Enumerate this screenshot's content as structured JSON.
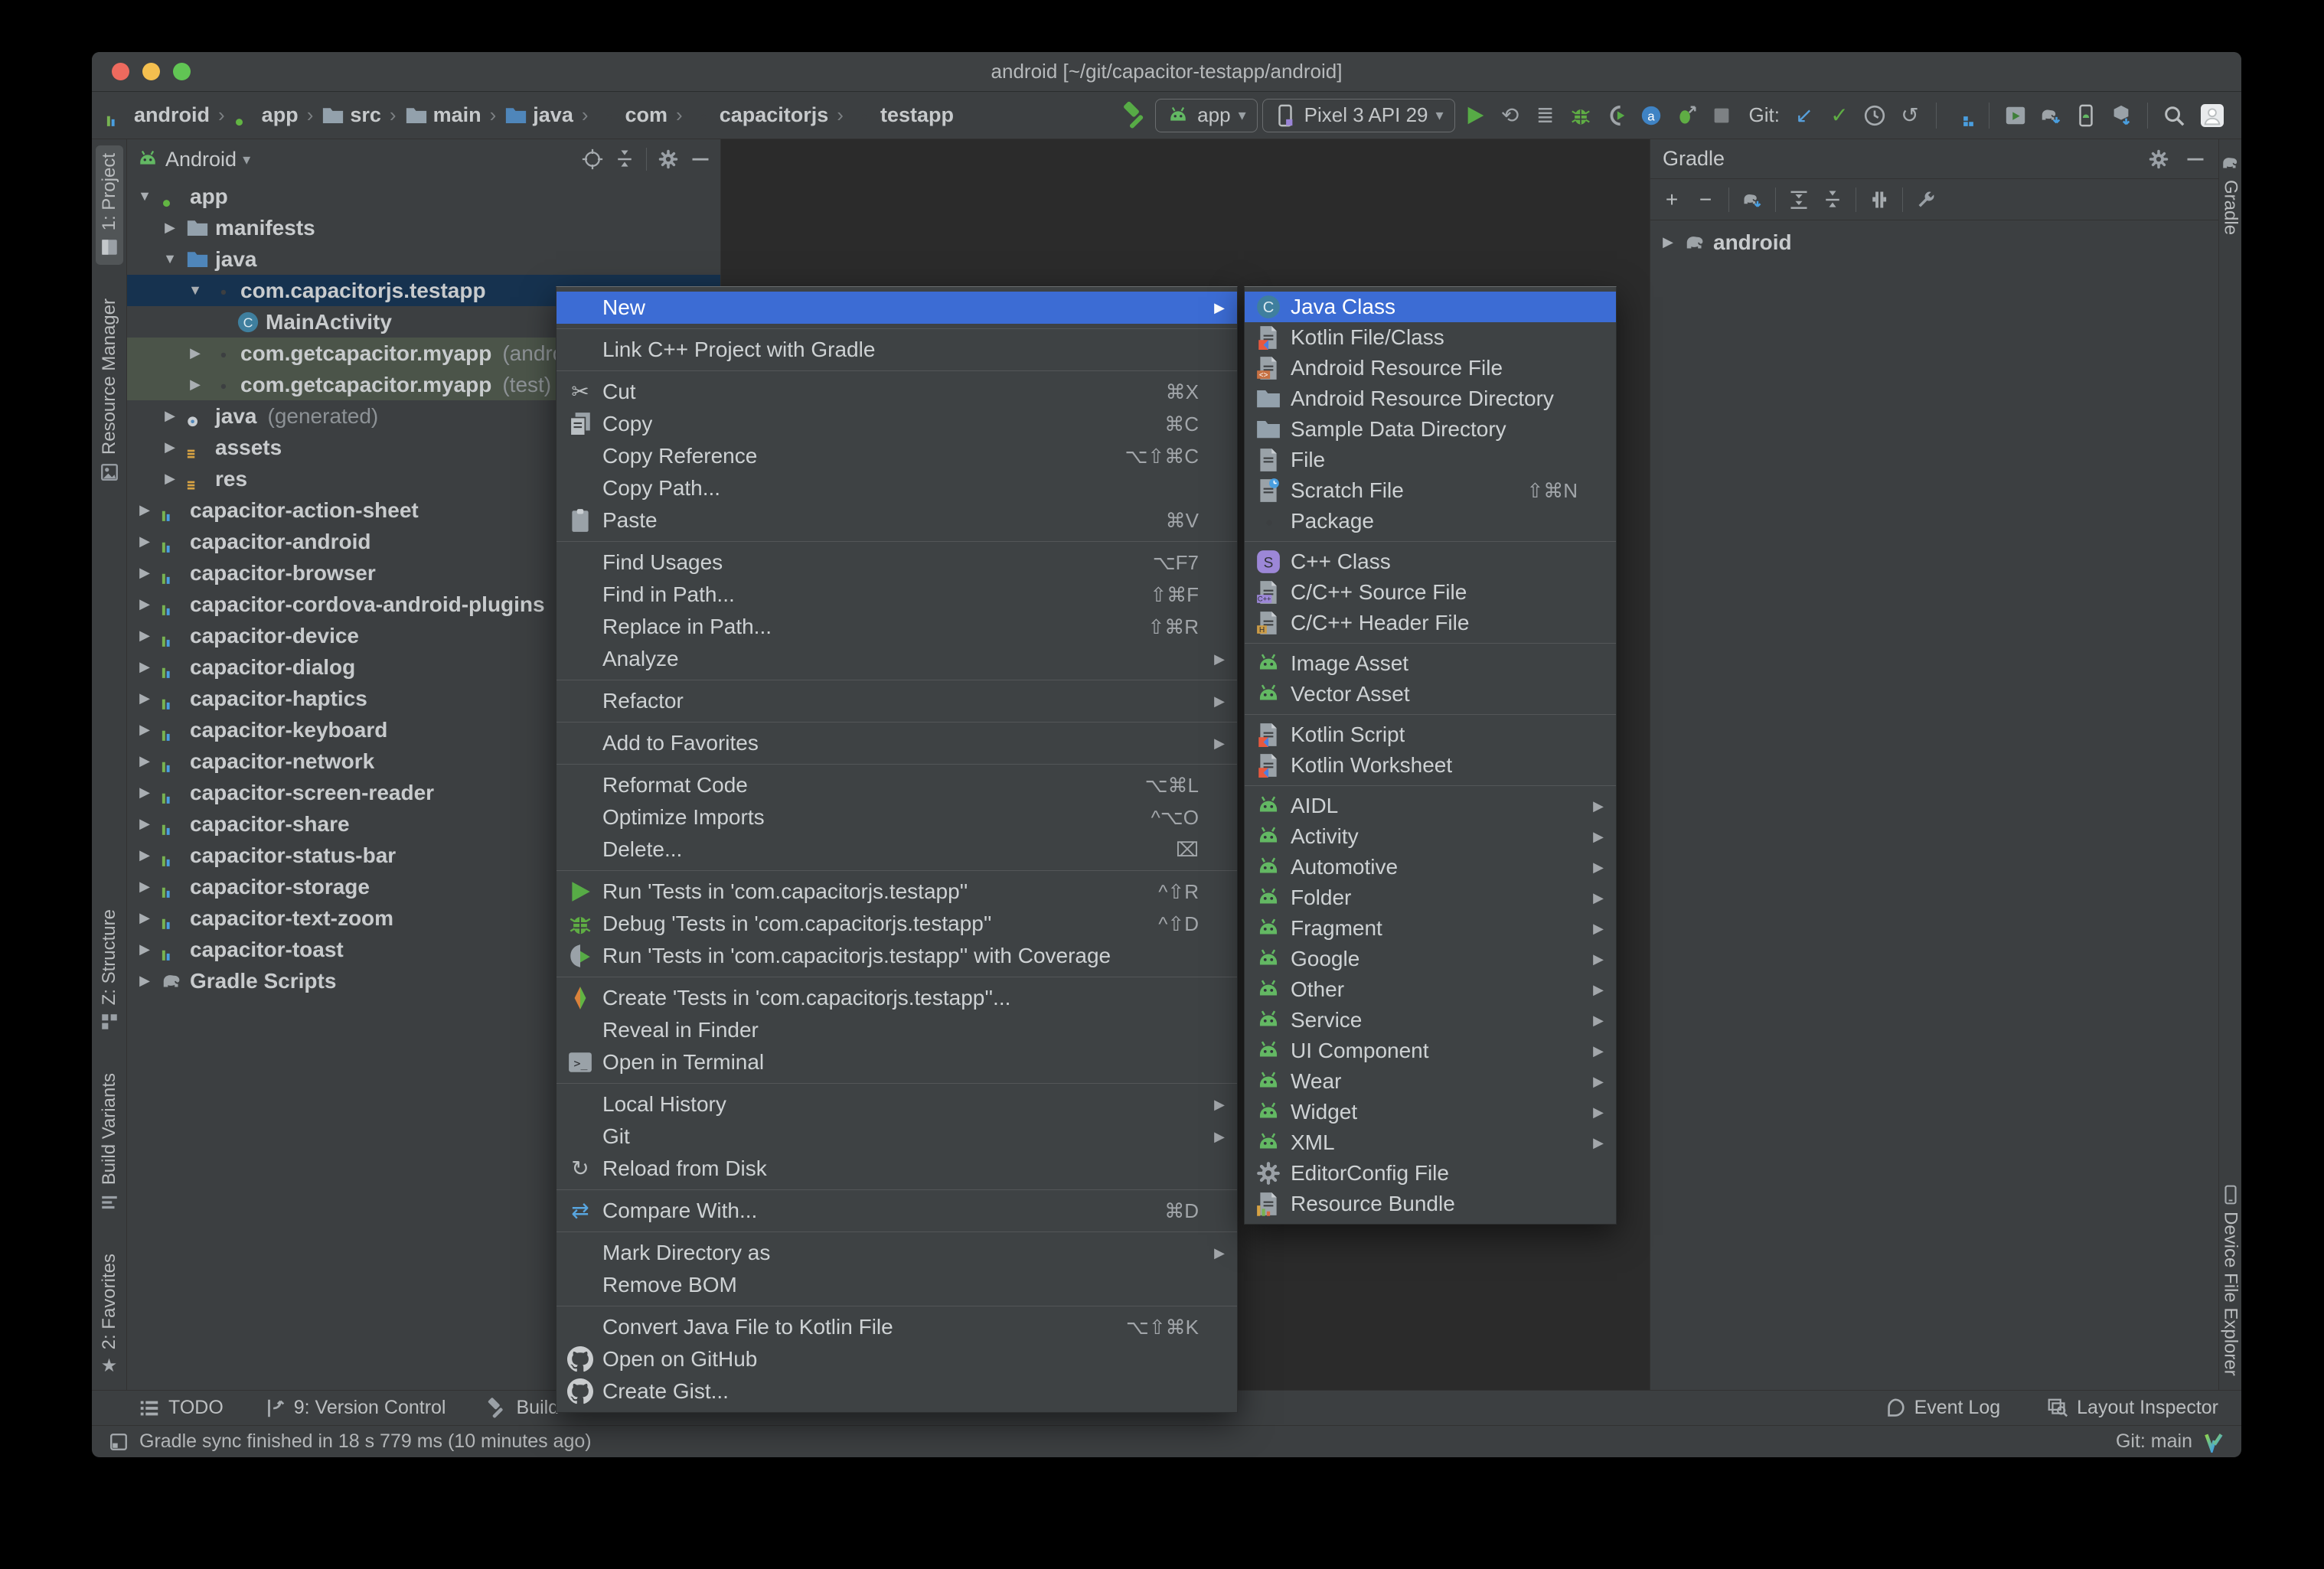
{
  "window": {
    "title": "android [~/git/capacitor-testapp/android]"
  },
  "breadcrumbs": {
    "separator": "›",
    "items": [
      {
        "label": "android",
        "icon": "module"
      },
      {
        "label": "app",
        "icon": "folder-app"
      },
      {
        "label": "src",
        "icon": "folder"
      },
      {
        "label": "main",
        "icon": "folder"
      },
      {
        "label": "java",
        "icon": "folder-blue"
      },
      {
        "label": "com",
        "icon": "package"
      },
      {
        "label": "capacitorjs",
        "icon": "package"
      },
      {
        "label": "testapp",
        "icon": "package"
      }
    ]
  },
  "run_toolbar": {
    "run_config": {
      "label": "app",
      "icon": "android"
    },
    "device": {
      "label": "Pixel 3 API 29",
      "icon": "phone"
    },
    "git_label": "Git:",
    "run_controls": [
      "run",
      "apply-changes",
      "apply-code-changes",
      "debug",
      "attach-debugger",
      "profiler",
      "attach-profiler",
      "stop"
    ],
    "git_controls": [
      "update-project",
      "commit",
      "history",
      "rollback"
    ],
    "manage_controls": [
      "project-structure"
    ],
    "device_controls": [
      "device-manager",
      "gradle-sync",
      "avd-manager",
      "sdk-manager"
    ],
    "misc_controls": [
      "search-everywhere",
      "profile-avatar"
    ]
  },
  "left_stripe": {
    "tabs": [
      {
        "label": "1: Project",
        "icon": "project-tab",
        "active": true
      },
      {
        "label": "Resource Manager",
        "icon": "resource-manager"
      },
      {
        "label": "Z: Structure",
        "icon": "structure"
      },
      {
        "label": "Build Variants",
        "icon": "build-variants"
      },
      {
        "label": "2: Favorites",
        "icon": "star"
      }
    ]
  },
  "project_panel": {
    "view_selector": "Android",
    "header_icons": [
      "locate",
      "collapse-all",
      "settings",
      "hide"
    ],
    "tree": [
      {
        "label": "app",
        "icon": "folder-app",
        "caret": "expanded",
        "indent": 0
      },
      {
        "label": "manifests",
        "icon": "folder",
        "caret": "collapsed",
        "indent": 1
      },
      {
        "label": "java",
        "icon": "folder-blue",
        "caret": "expanded",
        "indent": 1
      },
      {
        "label": "com.capacitorjs.testapp",
        "icon": "package",
        "caret": "expanded",
        "indent": 2,
        "state": "selected"
      },
      {
        "label": "MainActivity",
        "icon": "java-class",
        "indent": 3
      },
      {
        "label": "com.getcapacitor.myapp",
        "suffix": "(androidTest)",
        "icon": "package",
        "caret": "collapsed",
        "indent": 2,
        "state": "test"
      },
      {
        "label": "com.getcapacitor.myapp",
        "suffix": "(test)",
        "icon": "package",
        "caret": "collapsed",
        "indent": 2,
        "state": "test"
      },
      {
        "label": "java",
        "suffix": "(generated)",
        "icon": "folder-gen",
        "caret": "collapsed",
        "indent": 1
      },
      {
        "label": "assets",
        "icon": "folder-res",
        "caret": "collapsed",
        "indent": 1
      },
      {
        "label": "res",
        "icon": "folder-res",
        "caret": "collapsed",
        "indent": 1
      },
      {
        "label": "capacitor-action-sheet",
        "icon": "module",
        "caret": "collapsed",
        "indent": 0
      },
      {
        "label": "capacitor-android",
        "icon": "module",
        "caret": "collapsed",
        "indent": 0
      },
      {
        "label": "capacitor-browser",
        "icon": "module",
        "caret": "collapsed",
        "indent": 0
      },
      {
        "label": "capacitor-cordova-android-plugins",
        "icon": "module",
        "caret": "collapsed",
        "indent": 0
      },
      {
        "label": "capacitor-device",
        "icon": "module",
        "caret": "collapsed",
        "indent": 0
      },
      {
        "label": "capacitor-dialog",
        "icon": "module",
        "caret": "collapsed",
        "indent": 0
      },
      {
        "label": "capacitor-haptics",
        "icon": "module",
        "caret": "collapsed",
        "indent": 0
      },
      {
        "label": "capacitor-keyboard",
        "icon": "module",
        "caret": "collapsed",
        "indent": 0
      },
      {
        "label": "capacitor-network",
        "icon": "module",
        "caret": "collapsed",
        "indent": 0
      },
      {
        "label": "capacitor-screen-reader",
        "icon": "module",
        "caret": "collapsed",
        "indent": 0
      },
      {
        "label": "capacitor-share",
        "icon": "module",
        "caret": "collapsed",
        "indent": 0
      },
      {
        "label": "capacitor-status-bar",
        "icon": "module",
        "caret": "collapsed",
        "indent": 0
      },
      {
        "label": "capacitor-storage",
        "icon": "module",
        "caret": "collapsed",
        "indent": 0
      },
      {
        "label": "capacitor-text-zoom",
        "icon": "module",
        "caret": "collapsed",
        "indent": 0
      },
      {
        "label": "capacitor-toast",
        "icon": "module",
        "caret": "collapsed",
        "indent": 0
      },
      {
        "label": "Gradle Scripts",
        "icon": "elephant",
        "caret": "collapsed",
        "indent": 0
      }
    ]
  },
  "gradle_panel": {
    "title": "Gradle",
    "header_icons": [
      "settings",
      "hide"
    ],
    "toolbar_icons": [
      "add",
      "remove",
      "gradle-sync",
      "expand-all",
      "collapse-all",
      "offline-mode",
      "wrench"
    ],
    "tree": [
      {
        "label": "android",
        "icon": "elephant",
        "caret": "collapsed",
        "indent": 0
      }
    ]
  },
  "right_stripe": {
    "tabs": [
      {
        "label": "Gradle",
        "icon": "elephant"
      },
      {
        "label": "Device File Explorer",
        "icon": "device"
      }
    ]
  },
  "context_menu": {
    "items": [
      {
        "label": "New",
        "arrow": true,
        "selected": true
      },
      {
        "type": "separator"
      },
      {
        "label": "Link C++ Project with Gradle"
      },
      {
        "type": "separator"
      },
      {
        "label": "Cut",
        "icon": "scissors",
        "shortcut": "⌘X"
      },
      {
        "label": "Copy",
        "icon": "copy",
        "shortcut": "⌘C"
      },
      {
        "label": "Copy Reference",
        "shortcut": "⌥⇧⌘C"
      },
      {
        "label": "Copy Path..."
      },
      {
        "label": "Paste",
        "icon": "paste",
        "shortcut": "⌘V"
      },
      {
        "type": "separator"
      },
      {
        "label": "Find Usages",
        "shortcut": "⌥F7"
      },
      {
        "label": "Find in Path...",
        "shortcut": "⇧⌘F"
      },
      {
        "label": "Replace in Path...",
        "shortcut": "⇧⌘R"
      },
      {
        "label": "Analyze",
        "arrow": true
      },
      {
        "type": "separator"
      },
      {
        "label": "Refactor",
        "arrow": true
      },
      {
        "type": "separator"
      },
      {
        "label": "Add to Favorites",
        "arrow": true
      },
      {
        "type": "separator"
      },
      {
        "label": "Reformat Code",
        "shortcut": "⌥⌘L"
      },
      {
        "label": "Optimize Imports",
        "shortcut": "^⌥O"
      },
      {
        "label": "Delete...",
        "shortcut": "⌧"
      },
      {
        "type": "separator"
      },
      {
        "label": "Run 'Tests in 'com.capacitorjs.testapp''",
        "icon": "run",
        "shortcut": "^⇧R"
      },
      {
        "label": "Debug 'Tests in 'com.capacitorjs.testapp''",
        "icon": "debug",
        "shortcut": "^⇧D"
      },
      {
        "label": "Run 'Tests in 'com.capacitorjs.testapp'' with Coverage",
        "icon": "coverage"
      },
      {
        "type": "separator"
      },
      {
        "label": "Create 'Tests in 'com.capacitorjs.testapp''...",
        "icon": "create-tests"
      },
      {
        "label": "Reveal in Finder"
      },
      {
        "label": "Open in Terminal",
        "icon": "terminal"
      },
      {
        "type": "separator"
      },
      {
        "label": "Local History",
        "arrow": true
      },
      {
        "label": "Git",
        "arrow": true
      },
      {
        "label": "Reload from Disk",
        "icon": "reload"
      },
      {
        "type": "separator"
      },
      {
        "label": "Compare With...",
        "icon": "compare",
        "shortcut": "⌘D"
      },
      {
        "type": "separator"
      },
      {
        "label": "Mark Directory as",
        "arrow": true
      },
      {
        "label": "Remove BOM"
      },
      {
        "type": "separator"
      },
      {
        "label": "Convert Java File to Kotlin File",
        "shortcut": "⌥⇧⌘K"
      },
      {
        "label": "Open on GitHub",
        "icon": "github"
      },
      {
        "label": "Create Gist...",
        "icon": "github"
      }
    ]
  },
  "new_submenu": {
    "items": [
      {
        "label": "Java Class",
        "icon": "java-class",
        "selected": true
      },
      {
        "label": "Kotlin File/Class",
        "icon": "kotlin-file"
      },
      {
        "label": "Android Resource File",
        "icon": "android-res-file"
      },
      {
        "label": "Android Resource Directory",
        "icon": "folder"
      },
      {
        "label": "Sample Data Directory",
        "icon": "folder"
      },
      {
        "label": "File",
        "icon": "file"
      },
      {
        "label": "Scratch File",
        "icon": "scratch-file",
        "shortcut": "⇧⌘N"
      },
      {
        "label": "Package",
        "icon": "package"
      },
      {
        "type": "separator"
      },
      {
        "label": "C++ Class",
        "icon": "cpp-class"
      },
      {
        "label": "C/C++ Source File",
        "icon": "cpp-source"
      },
      {
        "label": "C/C++ Header File",
        "icon": "cpp-header"
      },
      {
        "type": "separator"
      },
      {
        "label": "Image Asset",
        "icon": "android"
      },
      {
        "label": "Vector Asset",
        "icon": "android"
      },
      {
        "type": "separator"
      },
      {
        "label": "Kotlin Script",
        "icon": "kotlin-file"
      },
      {
        "label": "Kotlin Worksheet",
        "icon": "kotlin-file"
      },
      {
        "type": "separator"
      },
      {
        "label": "AIDL",
        "icon": "android",
        "arrow": true
      },
      {
        "label": "Activity",
        "icon": "android",
        "arrow": true
      },
      {
        "label": "Automotive",
        "icon": "android",
        "arrow": true
      },
      {
        "label": "Folder",
        "icon": "android",
        "arrow": true
      },
      {
        "label": "Fragment",
        "icon": "android",
        "arrow": true
      },
      {
        "label": "Google",
        "icon": "android",
        "arrow": true
      },
      {
        "label": "Other",
        "icon": "android",
        "arrow": true
      },
      {
        "label": "Service",
        "icon": "android",
        "arrow": true
      },
      {
        "label": "UI Component",
        "icon": "android",
        "arrow": true
      },
      {
        "label": "Wear",
        "icon": "android",
        "arrow": true
      },
      {
        "label": "Widget",
        "icon": "android",
        "arrow": true
      },
      {
        "label": "XML",
        "icon": "android",
        "arrow": true
      },
      {
        "label": "EditorConfig File",
        "icon": "gear"
      },
      {
        "label": "Resource Bundle",
        "icon": "resource-bundle"
      }
    ]
  },
  "bottom_bar": {
    "left": [
      {
        "label": "TODO",
        "icon": "todo"
      },
      {
        "label": "9: Version Control",
        "icon": "version-control"
      },
      {
        "label": "Build",
        "icon": "build-hammer"
      }
    ],
    "right": [
      {
        "label": "Event Log",
        "icon": "event-log"
      },
      {
        "label": "Layout Inspector",
        "icon": "layout-inspector"
      }
    ]
  },
  "status_bar": {
    "message": "Gradle sync finished in 18 s 779 ms (10 minutes ago)",
    "git_branch": "Git: main"
  },
  "colors": {
    "selection_blue": "#3c6cd4",
    "tree_selection": "#16324f",
    "test_source_green": "#4b5449",
    "android_green": "#63b863",
    "run_green": "#57ab46",
    "traffic_red": "#ed6a5e",
    "traffic_yellow": "#f4bf4f",
    "traffic_green": "#61c554"
  }
}
